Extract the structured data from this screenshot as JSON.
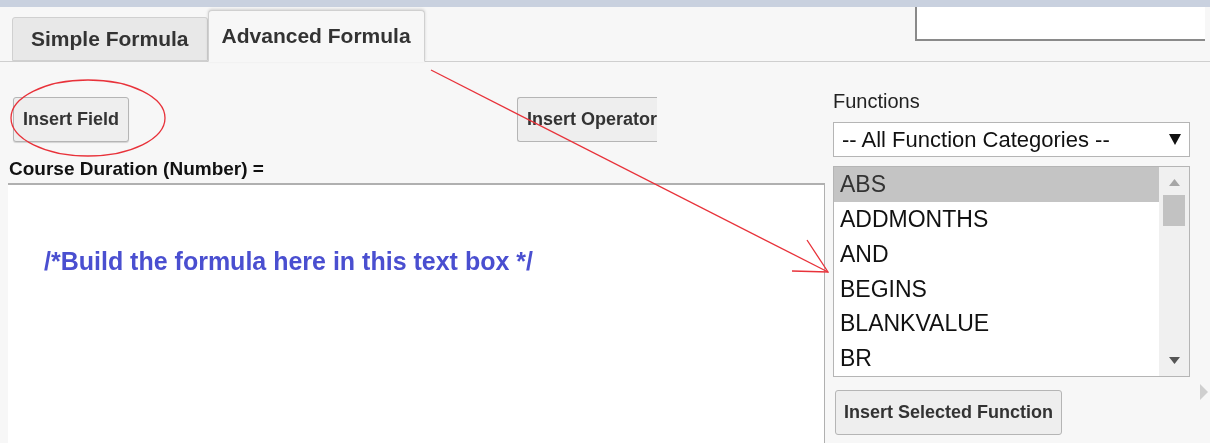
{
  "tabs": [
    {
      "label": "Simple Formula",
      "selected": false
    },
    {
      "label": "Advanced Formula",
      "selected": true
    }
  ],
  "toolbar": {
    "insert_field": "Insert Field",
    "insert_operator": "Insert Operator"
  },
  "formula": {
    "label": "Course Duration (Number) =",
    "value": "/*Build the formula here in this text box */"
  },
  "functions": {
    "label": "Functions",
    "category": "-- All Function Categories --",
    "items": [
      {
        "label": "ABS",
        "selected": true
      },
      {
        "label": "ADDMONTHS",
        "selected": false
      },
      {
        "label": "AND",
        "selected": false
      },
      {
        "label": "BEGINS",
        "selected": false
      },
      {
        "label": "BLANKVALUE",
        "selected": false
      },
      {
        "label": "BR",
        "selected": false
      }
    ],
    "insert_button": "Insert Selected Function"
  }
}
